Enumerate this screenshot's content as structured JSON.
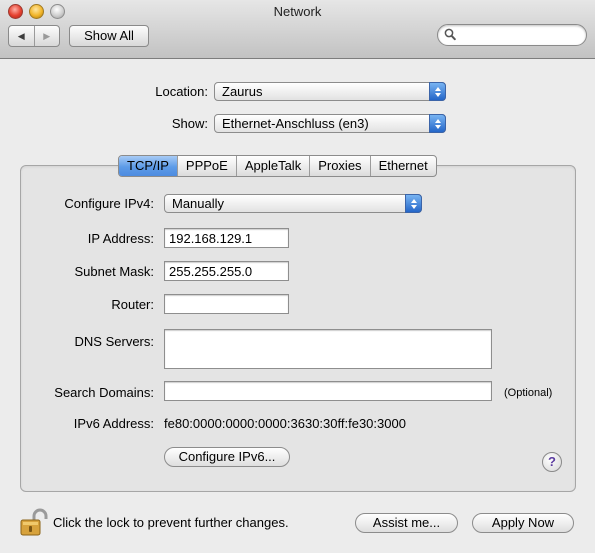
{
  "window": {
    "title": "Network"
  },
  "toolbar": {
    "back_icon": "back-arrow-icon",
    "forward_icon": "forward-arrow-icon",
    "show_all_label": "Show All",
    "search_placeholder": "",
    "search_icon": "magnifier-icon"
  },
  "location": {
    "label": "Location:",
    "value": "Zaurus"
  },
  "show": {
    "label": "Show:",
    "value": "Ethernet-Anschluss (en3)"
  },
  "tabs": [
    {
      "label": "TCP/IP",
      "active": true
    },
    {
      "label": "PPPoE",
      "active": false
    },
    {
      "label": "AppleTalk",
      "active": false
    },
    {
      "label": "Proxies",
      "active": false
    },
    {
      "label": "Ethernet",
      "active": false
    }
  ],
  "tcpip": {
    "configure_label": "Configure IPv4:",
    "configure_value": "Manually",
    "ip_label": "IP Address:",
    "ip_value": "192.168.129.1",
    "subnet_label": "Subnet Mask:",
    "subnet_value": "255.255.255.0",
    "router_label": "Router:",
    "router_value": "",
    "dns_label": "DNS Servers:",
    "dns_value": "",
    "search_domains_label": "Search Domains:",
    "search_domains_value": "",
    "optional_label": "(Optional)",
    "ipv6_label": "IPv6 Address:",
    "ipv6_value": "fe80:0000:0000:0000:3630:30ff:fe30:3000",
    "configure_ipv6_button": "Configure IPv6...",
    "help_label": "?"
  },
  "footer": {
    "lock_message": "Click the lock to prevent further changes.",
    "assist_button": "Assist me...",
    "apply_button": "Apply Now"
  },
  "colors": {
    "accent_blue": "#5d9be7",
    "window_bg": "#ececec",
    "lock_gold": "#c9962e"
  }
}
